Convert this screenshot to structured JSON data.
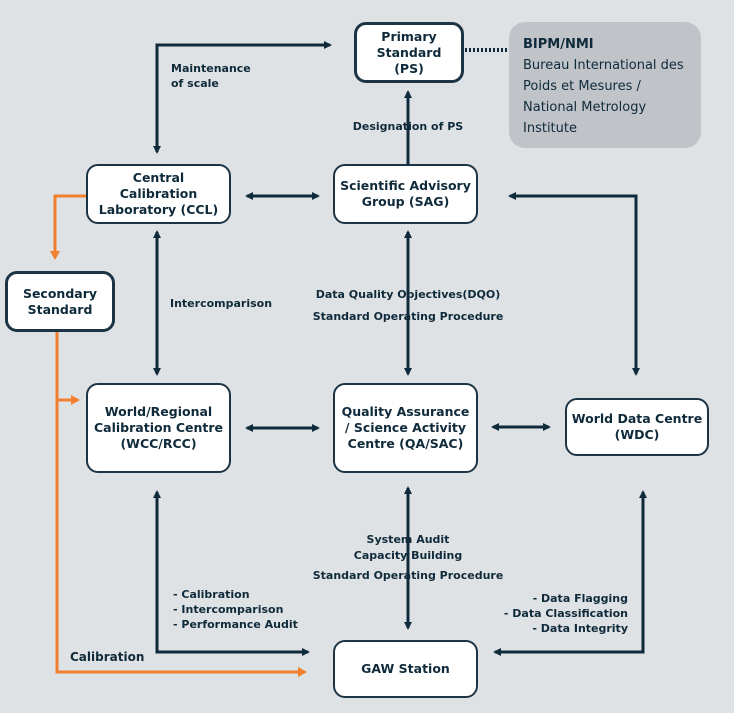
{
  "colors": {
    "background": "#dfe2e5",
    "line": "#0f2a3a",
    "orange": "#f07f2e",
    "note_fill": "#c0c3c8"
  },
  "nodes": {
    "ps": "Primary Standard (PS)",
    "ccl": "Central Calibration Laboratory (CCL)",
    "sag": "Scientific Advisory Group (SAG)",
    "secondary": "Secondary Standard",
    "wcc": "World/Regional Calibration Centre (WCC/RCC)",
    "qa": "Quality Assurance / Science Activity Centre (QA/SAC)",
    "wdc": "World Data Centre (WDC)",
    "gaw": "GAW Station"
  },
  "bipm": {
    "title": "BIPM/NMI",
    "text": "Bureau International des Poids et Mesures / National Metrology Institute"
  },
  "labels": {
    "maintenance": "Maintenance of scale",
    "designation": "Designation of PS",
    "intercomparison": "Intercomparison",
    "dqo": "Data Quality Objectives(DQO)",
    "sop1": "Standard Operating Procedure",
    "system_audit": "System Audit",
    "capacity": "Capacity Building",
    "sop2": "Standard Operating Procedure",
    "wcc_gaw": [
      "- Calibration",
      "- Intercomparison",
      "- Performance Audit"
    ],
    "wdc_gaw": [
      "- Data Flagging",
      "- Data Classification",
      "- Data Integrity"
    ],
    "calibration": "Calibration"
  }
}
